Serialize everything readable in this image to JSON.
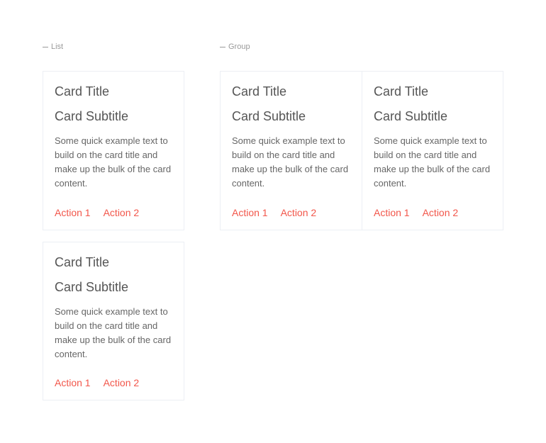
{
  "sections": {
    "list_label": "List",
    "group_label": "Group"
  },
  "colors": {
    "accent": "#f2564a"
  },
  "cards": {
    "list": [
      {
        "title": "Card Title",
        "subtitle": "Card Subtitle",
        "text": "Some quick example text to build on the card title and make up the bulk of the card content.",
        "action1": "Action 1",
        "action2": "Action 2"
      },
      {
        "title": "Card Title",
        "subtitle": "Card Subtitle",
        "text": "Some quick example text to build on the card title and make up the bulk of the card content.",
        "action1": "Action 1",
        "action2": "Action 2"
      }
    ],
    "group": [
      {
        "title": "Card Title",
        "subtitle": "Card Subtitle",
        "text": "Some quick example text to build on the card title and make up the bulk of the card content.",
        "action1": "Action 1",
        "action2": "Action 2"
      },
      {
        "title": "Card Title",
        "subtitle": "Card Subtitle",
        "text": "Some quick example text to build on the card title and make up the bulk of the card content.",
        "action1": "Action 1",
        "action2": "Action 2"
      }
    ]
  }
}
